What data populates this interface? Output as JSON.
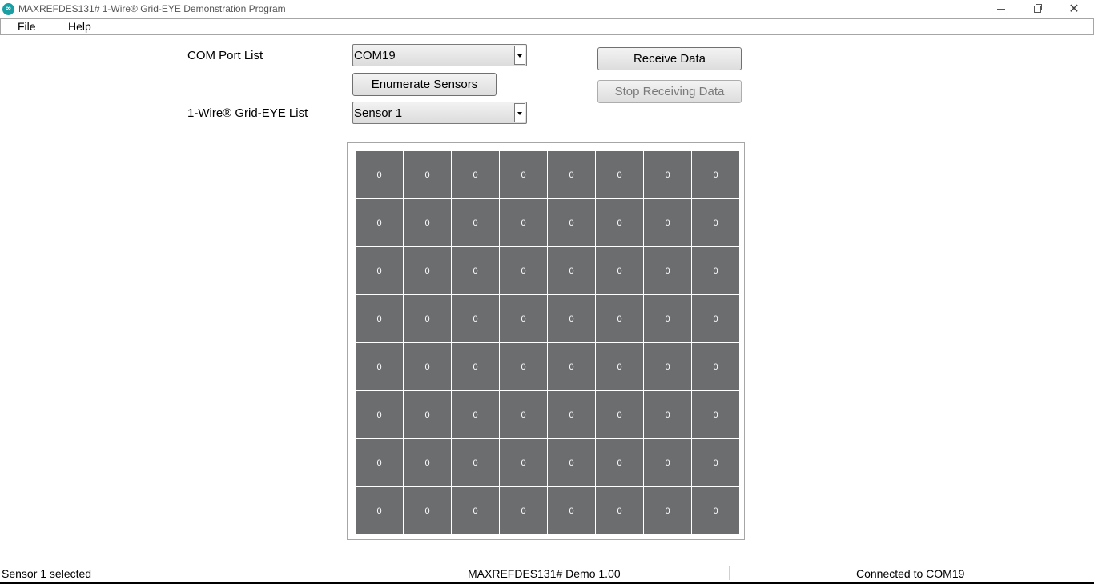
{
  "window": {
    "title": "MAXREFDES131# 1-Wire® Grid-EYE Demonstration Program",
    "icon_glyph": "∞",
    "close_glyph": "✕"
  },
  "menu": {
    "file": "File",
    "help": "Help"
  },
  "controls": {
    "com_port_label": "COM Port List",
    "com_port_value": "COM19",
    "enumerate_button": "Enumerate Sensors",
    "grid_eye_label": "1-Wire® Grid-EYE List",
    "grid_eye_value": "Sensor 1",
    "receive_button": "Receive Data",
    "stop_button": "Stop Receiving Data"
  },
  "grid": {
    "rows": [
      [
        "0",
        "0",
        "0",
        "0",
        "0",
        "0",
        "0",
        "0"
      ],
      [
        "0",
        "0",
        "0",
        "0",
        "0",
        "0",
        "0",
        "0"
      ],
      [
        "0",
        "0",
        "0",
        "0",
        "0",
        "0",
        "0",
        "0"
      ],
      [
        "0",
        "0",
        "0",
        "0",
        "0",
        "0",
        "0",
        "0"
      ],
      [
        "0",
        "0",
        "0",
        "0",
        "0",
        "0",
        "0",
        "0"
      ],
      [
        "0",
        "0",
        "0",
        "0",
        "0",
        "0",
        "0",
        "0"
      ],
      [
        "0",
        "0",
        "0",
        "0",
        "0",
        "0",
        "0",
        "0"
      ],
      [
        "0",
        "0",
        "0",
        "0",
        "0",
        "0",
        "0",
        "0"
      ]
    ],
    "cell_color": "#6b6d6e"
  },
  "status": {
    "left": "Sensor 1 selected",
    "middle": "MAXREFDES131# Demo 1.00",
    "right": "Connected to COM19"
  }
}
